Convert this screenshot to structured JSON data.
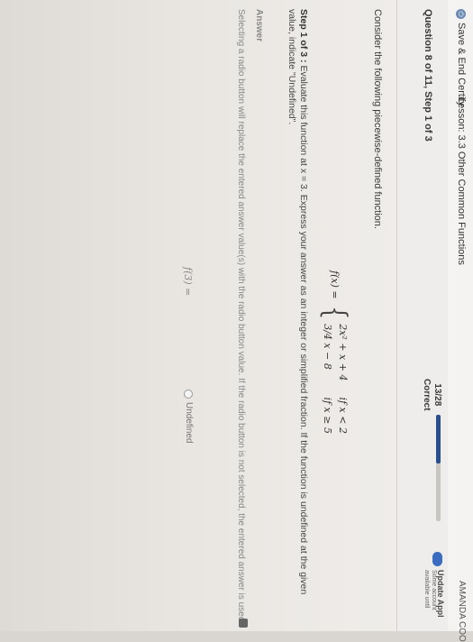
{
  "topbar": {
    "save_label": "Save & End Certify",
    "lesson": "Lesson: 3.3 Other Common Functions",
    "user": "AMANDA COO"
  },
  "question": {
    "title": "Question 8 of 11, Step 1 of 3",
    "score": "13/28",
    "status": "Correct",
    "progress_fraction": 0.46
  },
  "update": {
    "title": "Update Appl",
    "line1": "Some account",
    "line2": "available until"
  },
  "prompt": "Consider the following piecewise-defined function.",
  "function": {
    "lhs": "f(x) =",
    "case1_expr": "2x² + x + 4",
    "case1_cond": "if x < 2",
    "case2_expr": "3/4 x − 8",
    "case2_cond": "if x ≥ 5"
  },
  "step": {
    "label": "Step 1 of 3 :",
    "text": "Evaluate this function at x = 3. Express your answer as an integer or simplified fraction. If the function is undefined at the given value, indicate \"Undefined\"."
  },
  "answer": {
    "label": "Answer",
    "hint": "Selecting a radio button will replace the entered answer value(s) with the radio button value. If the radio button is not selected, the entered answer is used.",
    "f3_label": "f(3) =",
    "undefined_label": "Undefined"
  }
}
